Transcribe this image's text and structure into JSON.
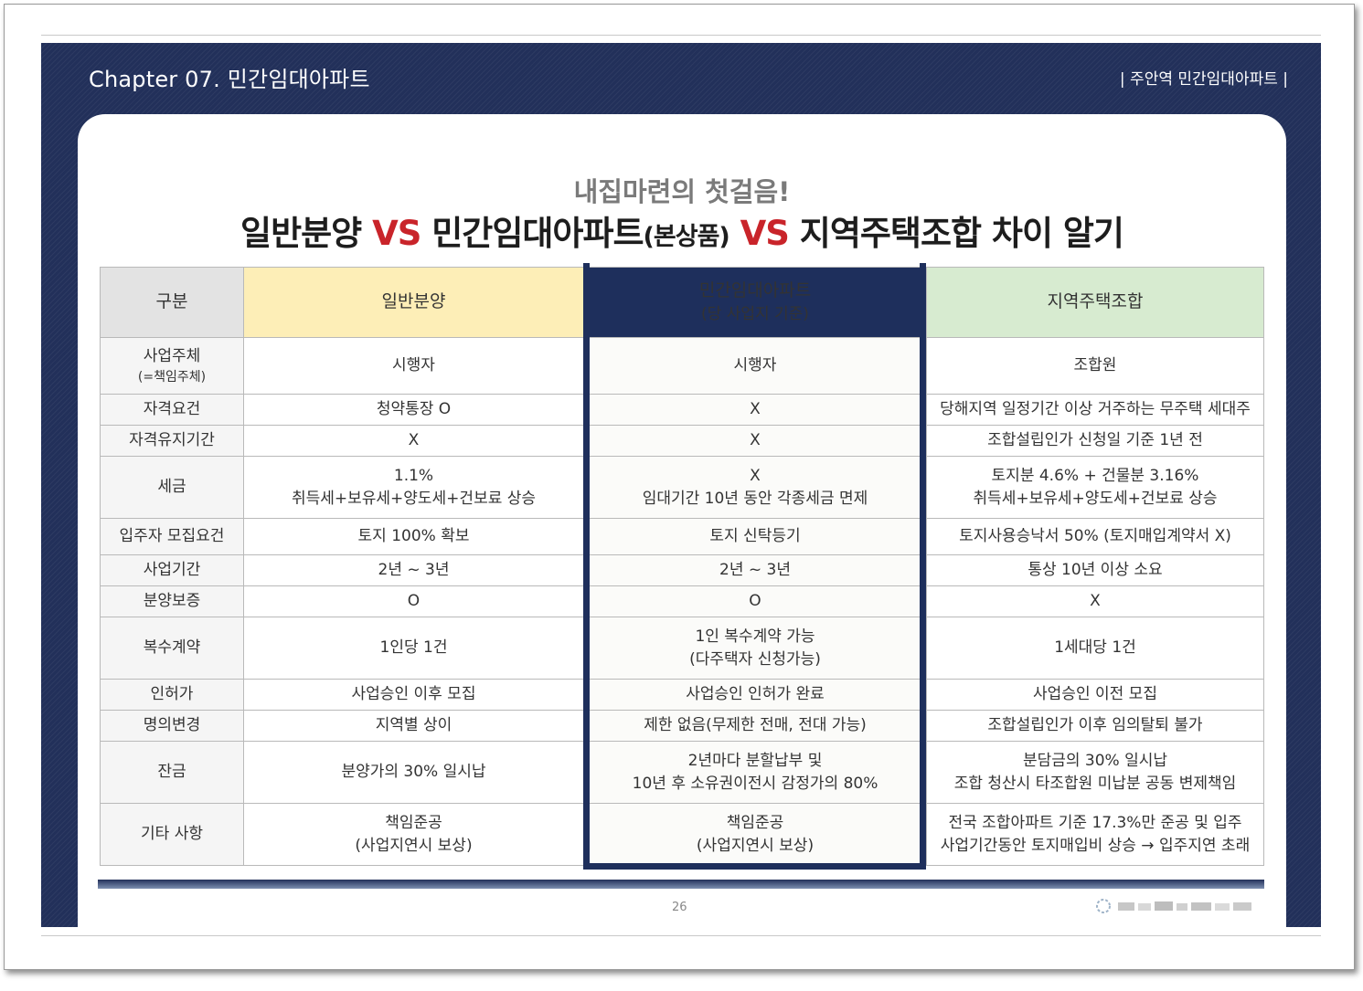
{
  "header": {
    "chapter": "Chapter 07. 민간임대아파트",
    "right_title": "|  주안역 민간임대아파트  |"
  },
  "title": {
    "subhead": "내집마련의 첫걸음!",
    "part1": "일반분양 ",
    "vs1": "VS",
    "part2": " 민간임대아파트",
    "part2_paren": "(본상품)",
    "vs2": " VS",
    "part3": " 지역주택조합 차이 알기"
  },
  "table": {
    "headers": {
      "label": "구분",
      "general": "일반분양",
      "private": "민간임대아파트",
      "private_sub": "(당 사업지 기준)",
      "regional": "지역주택조합"
    },
    "rows": [
      {
        "label": "사업주체",
        "label2": "(=책임주체)",
        "general": "시행자",
        "general2": "",
        "private": "시행자",
        "private2": "",
        "regional": "조합원",
        "regional2": ""
      },
      {
        "label": "자격요건",
        "label2": "",
        "general": "청약통장 O",
        "general2": "",
        "private": "X",
        "private2": "",
        "regional": "당해지역 일정기간 이상 거주하는 무주택 세대주",
        "regional2": ""
      },
      {
        "label": "자격유지기간",
        "label2": "",
        "general": "X",
        "general2": "",
        "private": "X",
        "private2": "",
        "regional": "조합설립인가 신청일 기준 1년 전",
        "regional2": ""
      },
      {
        "label": "세금",
        "label2": "",
        "general": "1.1%",
        "general2": "취득세+보유세+양도세+건보료 상승",
        "private": "X",
        "private2": "임대기간 10년 동안 각종세금 면제",
        "regional": "토지분 4.6% + 건물분 3.16%",
        "regional2": "취득세+보유세+양도세+건보료 상승"
      },
      {
        "label": "입주자 모집요건",
        "label2": "",
        "general": "토지 100% 확보",
        "general2": "",
        "private": "토지 신탁등기",
        "private2": "",
        "regional": "토지사용승낙서 50% (토지매입계약서 X)",
        "regional2": ""
      },
      {
        "label": "사업기간",
        "label2": "",
        "general": "2년 ~ 3년",
        "general2": "",
        "private": "2년 ~ 3년",
        "private2": "",
        "regional": "통상 10년 이상 소요",
        "regional2": ""
      },
      {
        "label": "분양보증",
        "label2": "",
        "general": "O",
        "general2": "",
        "private": "O",
        "private2": "",
        "regional": "X",
        "regional2": ""
      },
      {
        "label": "복수계약",
        "label2": "",
        "general": "1인당 1건",
        "general2": "",
        "private": "1인 복수계약 가능",
        "private2": "(다주택자 신청가능)",
        "regional": "1세대당 1건",
        "regional2": ""
      },
      {
        "label": "인허가",
        "label2": "",
        "general": "사업승인 이후 모집",
        "general2": "",
        "private": "사업승인 인허가 완료",
        "private2": "",
        "regional": "사업승인 이전 모집",
        "regional2": ""
      },
      {
        "label": "명의변경",
        "label2": "",
        "general": "지역별 상이",
        "general2": "",
        "private": "제한 없음(무제한 전매, 전대 가능)",
        "private2": "",
        "regional": "조합설립인가 이후 임의탈퇴 불가",
        "regional2": ""
      },
      {
        "label": "잔금",
        "label2": "",
        "general": "분양가의 30% 일시납",
        "general2": "",
        "private": "2년마다 분할납부 및",
        "private2": "10년 후 소유권이전시 감정가의 80%",
        "regional": "분담금의 30% 일시납",
        "regional2": "조합 청산시 타조합원 미납분 공동 변제책임"
      },
      {
        "label": "기타 사항",
        "label2": "",
        "general": "책임준공",
        "general2": "(사업지연시 보상)",
        "private": "책임준공",
        "private2": "(사업지연시 보상)",
        "regional": "전국 조합아파트 기준 17.3%만 준공 및 입주",
        "regional2": "사업기간동안 토지매입비 상승 → 입주지연 초래"
      }
    ]
  },
  "footer": {
    "page_number": "26"
  },
  "colors": {
    "navy": "#1e2f5c",
    "accent_red": "#c9242a",
    "general_header": "#fdeeb7",
    "regional_header": "#d7ebd0"
  }
}
